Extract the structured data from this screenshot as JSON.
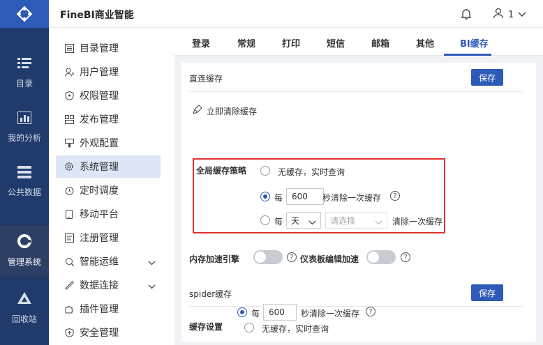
{
  "app": {
    "title": "FineBI商业智能"
  },
  "user": {
    "name": "1"
  },
  "rail": [
    {
      "label": "目录",
      "icon": "catalog-icon"
    },
    {
      "label": "我的分析",
      "icon": "analysis-icon"
    },
    {
      "label": "公共数据",
      "icon": "data-icon"
    },
    {
      "label": "管理系统",
      "icon": "system-icon",
      "active": true
    },
    {
      "label": "回收站",
      "icon": "recycle-icon"
    }
  ],
  "menu": [
    {
      "label": "目录管理",
      "icon": "directory-icon"
    },
    {
      "label": "用户管理",
      "icon": "user-icon"
    },
    {
      "label": "权限管理",
      "icon": "permission-icon"
    },
    {
      "label": "发布管理",
      "icon": "publish-icon"
    },
    {
      "label": "外观配置",
      "icon": "appearance-icon"
    },
    {
      "label": "系统管理",
      "icon": "gear-icon",
      "active": true
    },
    {
      "label": "定时调度",
      "icon": "timer-icon"
    },
    {
      "label": "移动平台",
      "icon": "mobile-icon"
    },
    {
      "label": "注册管理",
      "icon": "register-icon"
    },
    {
      "label": "智能运维",
      "icon": "ops-icon",
      "expandable": true
    },
    {
      "label": "数据连接",
      "icon": "link-icon",
      "expandable": true
    },
    {
      "label": "插件管理",
      "icon": "plugin-icon"
    },
    {
      "label": "安全管理",
      "icon": "shield-icon"
    }
  ],
  "tabs": [
    "登录",
    "常规",
    "打印",
    "短信",
    "邮箱",
    "其他",
    "BI缓存"
  ],
  "active_tab": "BI缓存",
  "direct_cache": {
    "title": "直连缓存",
    "save_label": "保存",
    "clear_label": "立即清除缓存",
    "strategy_label": "全局缓存策略",
    "opt_none": "无缓存，实时查询",
    "opt_every_prefix": "每",
    "seconds_value": "600",
    "seconds_suffix": "秒清除一次缓存",
    "every2_prefix": "每",
    "unit_value": "天",
    "time_placeholder": "请选择",
    "every2_suffix": "清除一次缓存",
    "help": "?"
  },
  "accel": {
    "memory_label": "内存加速引擎",
    "dashboard_label": "仪表板编辑加速",
    "memory_on": false,
    "dashboard_on": false
  },
  "spider_cache": {
    "title": "spider缓存",
    "save_label": "保存",
    "setting_label": "缓存设置",
    "opt_none": "无缓存，实时查询",
    "opt_every_prefix": "每",
    "seconds_value": "600",
    "seconds_suffix": "秒清除一次缓存"
  },
  "colors": {
    "accent": "#2e5ab8",
    "rail": "#1f3a6b",
    "highlight": "#e03131"
  }
}
